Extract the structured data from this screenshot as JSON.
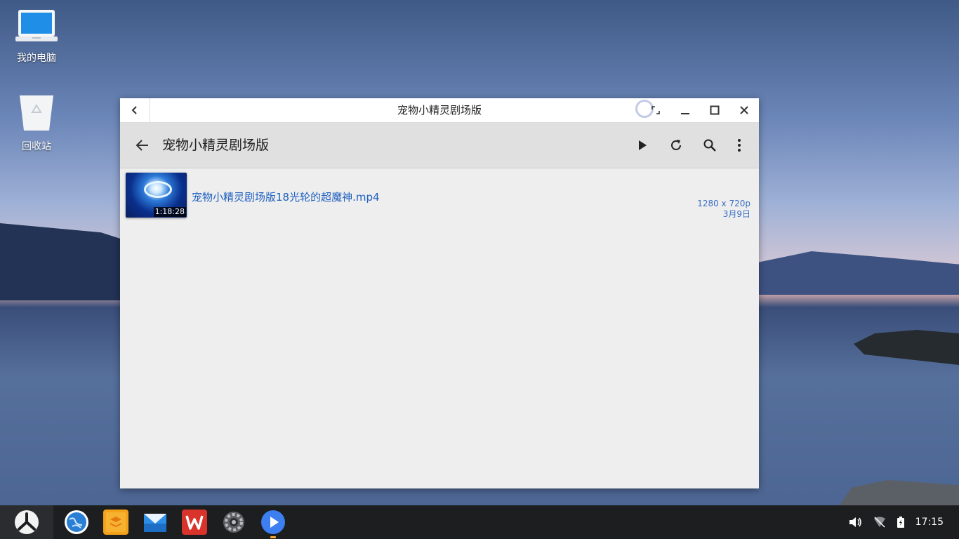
{
  "desktop": {
    "icons": [
      {
        "label": "我的电脑"
      },
      {
        "label": "回收站"
      }
    ]
  },
  "window": {
    "title": "宠物小精灵剧场版",
    "appbar_title": "宠物小精灵剧场版",
    "items": [
      {
        "name": "宠物小精灵剧场版18光轮的超魔神.mp4",
        "duration": "1:18:28",
        "resolution": "1280 x 720p",
        "date": "3月9日"
      }
    ]
  },
  "taskbar": {
    "clock": "17:15",
    "apps": [
      "browser-icon",
      "files-icon",
      "mail-icon",
      "wps-icon",
      "settings-icon",
      "video-player-icon"
    ]
  },
  "colors": {
    "accent": "#1e5fbf",
    "player": "#3d7ef0",
    "wps": "#d9342b"
  }
}
